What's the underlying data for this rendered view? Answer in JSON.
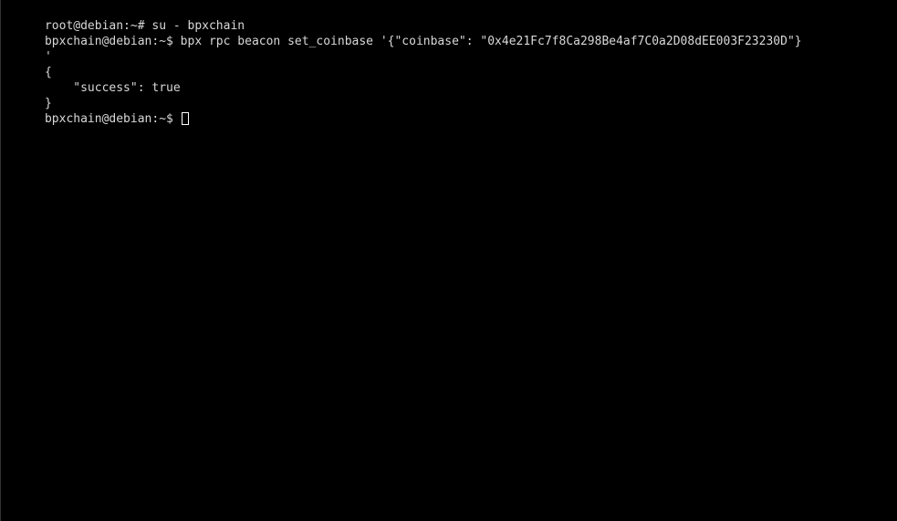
{
  "terminal": {
    "background_color": "#000000",
    "foreground_color": "#d8d8d8",
    "cursor_color": "#ffffff",
    "cursor_style": "hollow-block",
    "lines": [
      {
        "id": "line-1",
        "text": "root@debian:~# su - bpxchain"
      },
      {
        "id": "line-2",
        "text": "bpxchain@debian:~$ bpx rpc beacon set_coinbase '{\"coinbase\": \"0x4e21Fc7f8Ca298Be4af7C0a2D08dEE003F23230D\"}"
      },
      {
        "id": "line-3",
        "text": "'"
      },
      {
        "id": "line-4",
        "text": "{"
      },
      {
        "id": "line-5",
        "text": "    \"success\": true"
      },
      {
        "id": "line-6",
        "text": "}"
      },
      {
        "id": "line-7",
        "text": "bpxchain@debian:~$ "
      }
    ],
    "prompts": {
      "root_prompt": "root@debian:~#",
      "user_prompt": "bpxchain@debian:~$"
    },
    "commands": {
      "switch_user": "su - bpxchain",
      "set_coinbase": "bpx rpc beacon set_coinbase '{\"coinbase\": \"0x4e21Fc7f8Ca298Be4af7C0a2D08dEE003F23230D\"}'"
    },
    "response": {
      "open_brace": "{",
      "success_key": "\"success\"",
      "success_value": "true",
      "close_brace": "}",
      "coinbase_address": "0x4e21Fc7f8Ca298Be4af7C0a2D08dEE003F23230D"
    }
  }
}
